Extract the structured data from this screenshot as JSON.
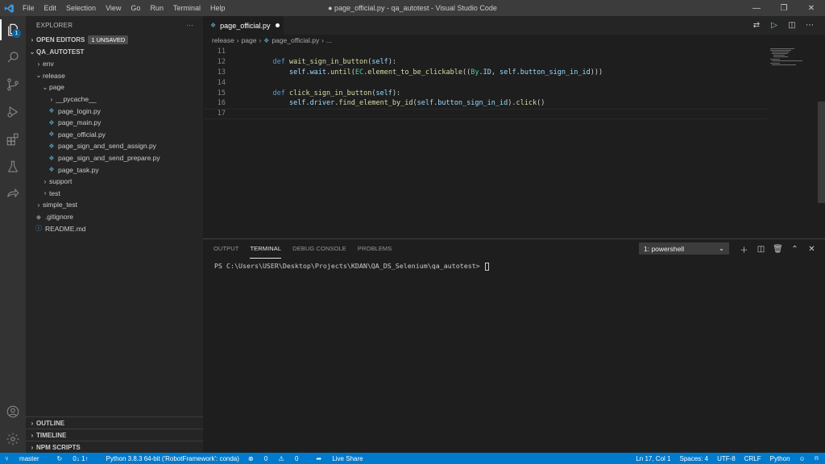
{
  "titlebar": {
    "menus": [
      "File",
      "Edit",
      "Selection",
      "View",
      "Go",
      "Run",
      "Terminal",
      "Help"
    ],
    "window_title": "● page_official.py - qa_autotest - Visual Studio Code"
  },
  "activity": {
    "explorer_badge": "1"
  },
  "sidebar": {
    "title": "EXPLORER",
    "more": "···",
    "open_editors": "OPEN EDITORS",
    "unsaved_badge": "1 UNSAVED",
    "root": "QA_AUTOTEST",
    "tree": [
      {
        "label": "env",
        "kind": "folder",
        "depth": 1,
        "open": false
      },
      {
        "label": "release",
        "kind": "folder",
        "depth": 1,
        "open": true
      },
      {
        "label": "page",
        "kind": "folder",
        "depth": 2,
        "open": true
      },
      {
        "label": "__pycache__",
        "kind": "folder",
        "depth": 3,
        "open": false
      },
      {
        "label": "page_login.py",
        "kind": "py",
        "depth": 3
      },
      {
        "label": "page_main.py",
        "kind": "py",
        "depth": 3
      },
      {
        "label": "page_official.py",
        "kind": "py",
        "depth": 3
      },
      {
        "label": "page_sign_and_send_assign.py",
        "kind": "py",
        "depth": 3
      },
      {
        "label": "page_sign_and_send_prepare.py",
        "kind": "py",
        "depth": 3
      },
      {
        "label": "page_task.py",
        "kind": "py",
        "depth": 3
      },
      {
        "label": "support",
        "kind": "folder",
        "depth": 2,
        "open": false
      },
      {
        "label": "test",
        "kind": "folder",
        "depth": 2,
        "open": false
      },
      {
        "label": "simple_test",
        "kind": "folder",
        "depth": 1,
        "open": false
      },
      {
        "label": ".gitignore",
        "kind": "git",
        "depth": 1
      },
      {
        "label": "README.md",
        "kind": "info",
        "depth": 1
      }
    ],
    "outline": "OUTLINE",
    "timeline": "TIMELINE",
    "npm_scripts": "NPM SCRIPTS"
  },
  "editor": {
    "tab_label": "page_official.py",
    "breadcrumb": [
      "release",
      "page",
      "page_official.py",
      "..."
    ],
    "lines": [
      {
        "n": "11",
        "code": ""
      },
      {
        "n": "12",
        "code": "    def wait_sign_in_button(self):"
      },
      {
        "n": "13",
        "code": "        self.wait.until(EC.element_to_be_clickable((By.ID, self.button_sign_in_id)))"
      },
      {
        "n": "14",
        "code": ""
      },
      {
        "n": "15",
        "code": "    def click_sign_in_button(self):"
      },
      {
        "n": "16",
        "code": "        self.driver.find_element_by_id(self.button_sign_in_id).click()"
      },
      {
        "n": "17",
        "code": ""
      }
    ]
  },
  "panel": {
    "tabs": [
      "OUTPUT",
      "TERMINAL",
      "DEBUG CONSOLE",
      "PROBLEMS"
    ],
    "active_tab": "TERMINAL",
    "terminal_select": "1: powershell",
    "prompt": "PS C:\\Users\\USER\\Desktop\\Projects\\KDAN\\QA_DS_Selenium\\qa_autotest> "
  },
  "statusbar": {
    "branch": "master",
    "sync": "0↓ 1↑",
    "interpreter": "Python 3.8.3 64-bit ('RobotFramework': conda)",
    "errors": "0",
    "warnings": "0",
    "live_share": "Live Share",
    "position": "Ln 17, Col 1",
    "spaces": "Spaces: 4",
    "encoding": "UTF-8",
    "eol": "CRLF",
    "language": "Python"
  },
  "colors": {
    "accent": "#007acc",
    "titlebar": "#3c3c3c",
    "sidebar": "#252526",
    "editor": "#1e1e1e"
  }
}
